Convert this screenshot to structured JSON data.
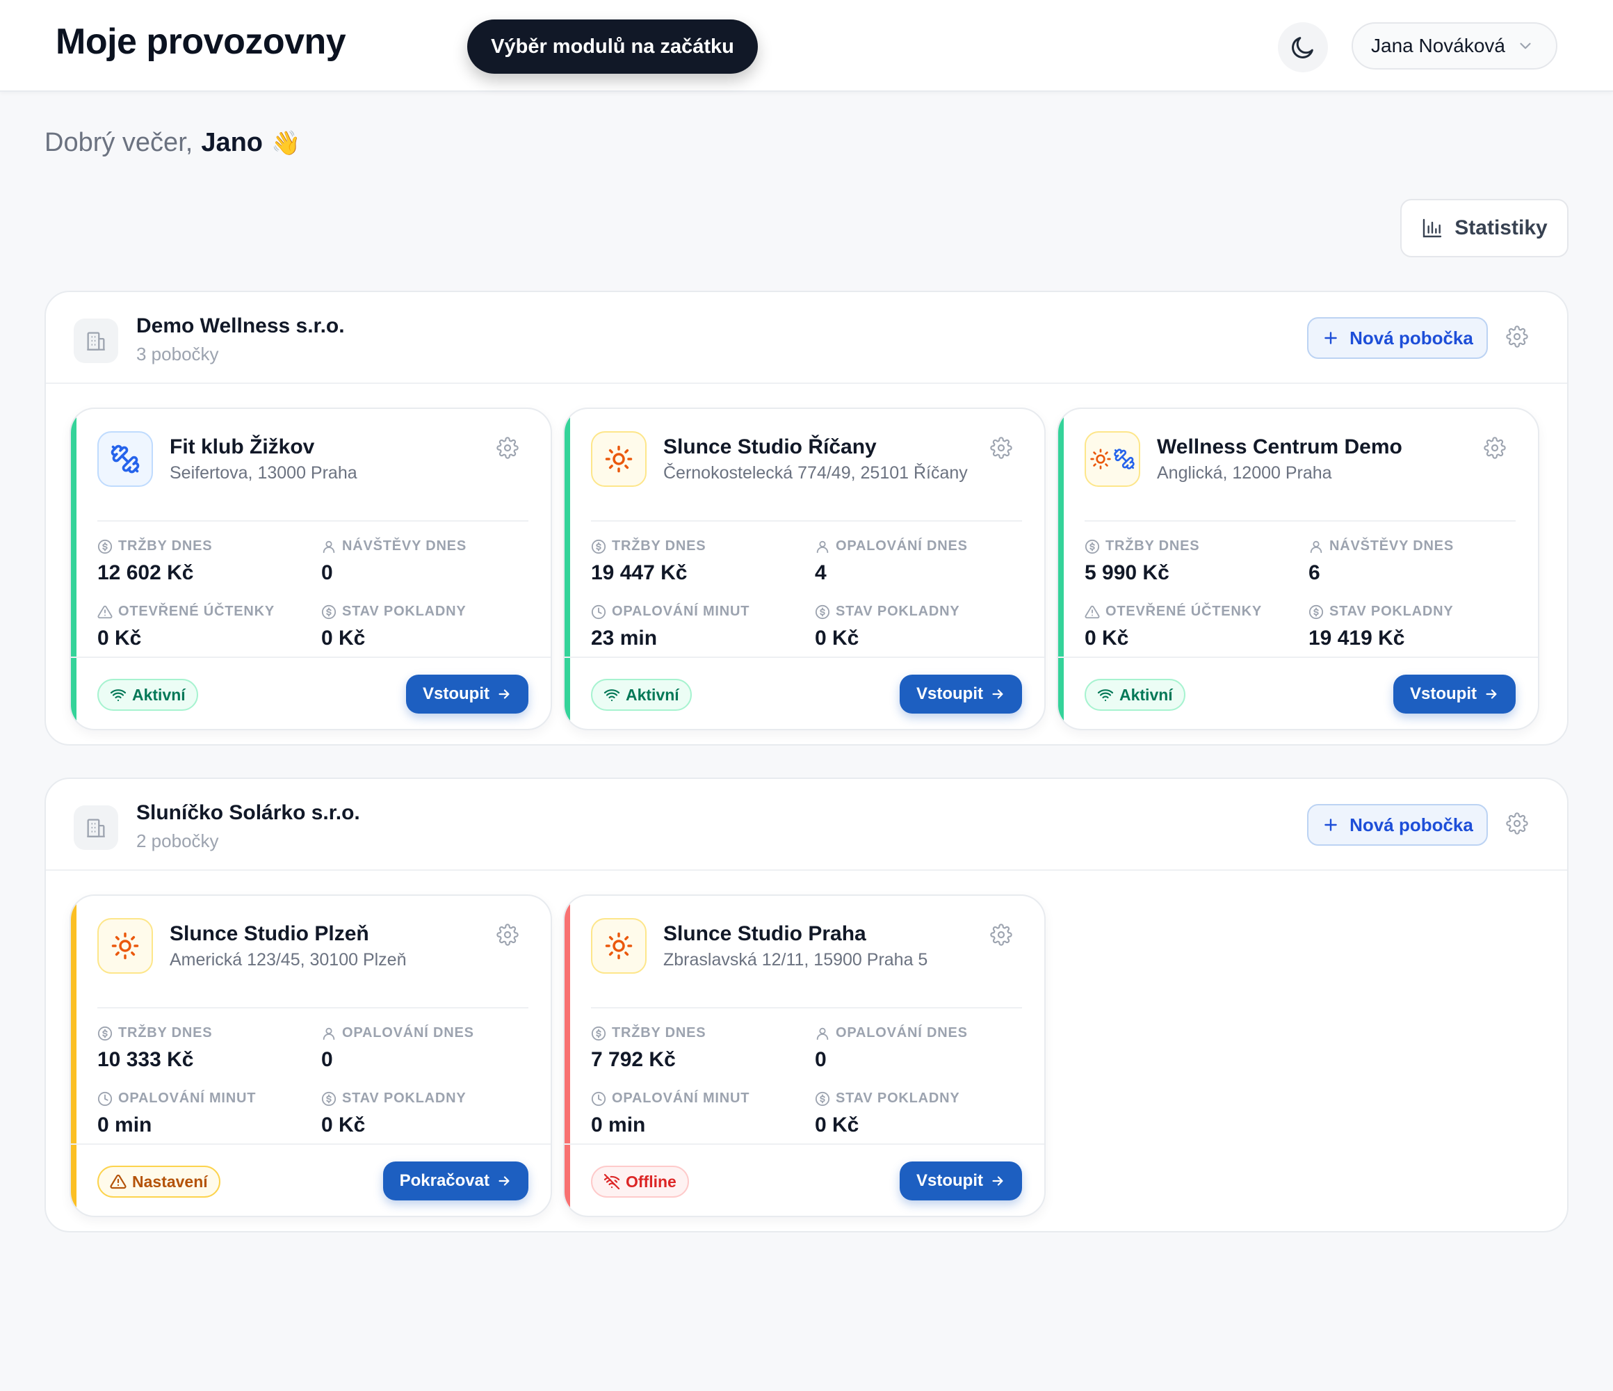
{
  "header": {
    "title": "Moje provozovny",
    "tooltip": "Výběr modulů na začátku",
    "theme_icon": "moon-icon",
    "user_name": "Jana Nováková"
  },
  "greeting": {
    "prefix": "Dobrý večer,",
    "name": "Jano",
    "emoji": "👋"
  },
  "stats_button": "Statistiky",
  "colors": {
    "accent_blue": "#1d5fc1",
    "active_green": "#34d399",
    "setup_amber": "#fbbf24",
    "offline_red": "#f87171"
  },
  "companies": [
    {
      "name": "Demo Wellness s.r.o.",
      "count": "3 pobočky",
      "new_branch": "Nová pobočka",
      "branches": [
        {
          "name": "Fit klub Žižkov",
          "address": "Seifertova, 13000 Praha",
          "icon": "dumbbell-icon",
          "metrics": [
            {
              "label": "Tržby dnes",
              "icon": "dollar-icon",
              "value": "12 602 Kč"
            },
            {
              "label": "Návštěvy dnes",
              "icon": "user-icon",
              "value": "0"
            },
            {
              "label": "Otevřené účtenky",
              "icon": "warning-icon",
              "value": "0 Kč"
            },
            {
              "label": "Stav pokladny",
              "icon": "dollar-icon",
              "value": "0 Kč"
            }
          ],
          "status": "Aktivní",
          "action": "Vstoupit"
        },
        {
          "name": "Slunce Studio Říčany",
          "address": "Černokostelecká 774/49, 25101 Říčany",
          "icon": "sun-icon",
          "metrics": [
            {
              "label": "Tržby dnes",
              "icon": "dollar-icon",
              "value": "19 447 Kč"
            },
            {
              "label": "Opalování dnes",
              "icon": "user-icon",
              "value": "4"
            },
            {
              "label": "Opalování minut",
              "icon": "clock-icon",
              "value": "23 min"
            },
            {
              "label": "Stav pokladny",
              "icon": "dollar-icon",
              "value": "0 Kč"
            }
          ],
          "status": "Aktivní",
          "action": "Vstoupit"
        },
        {
          "name": "Wellness Centrum Demo",
          "address": "Anglická, 12000 Praha",
          "icon": "sun-dumbbell-icon",
          "metrics": [
            {
              "label": "Tržby dnes",
              "icon": "dollar-icon",
              "value": "5 990 Kč"
            },
            {
              "label": "Návštěvy dnes",
              "icon": "user-icon",
              "value": "6"
            },
            {
              "label": "Otevřené účtenky",
              "icon": "warning-icon",
              "value": "0 Kč"
            },
            {
              "label": "Stav pokladny",
              "icon": "dollar-icon",
              "value": "19 419 Kč"
            }
          ],
          "status": "Aktivní",
          "action": "Vstoupit"
        }
      ]
    },
    {
      "name": "Sluníčko Solárko s.r.o.",
      "count": "2 pobočky",
      "new_branch": "Nová pobočka",
      "branches": [
        {
          "name": "Slunce Studio Plzeň",
          "address": "Americká 123/45, 30100 Plzeň",
          "icon": "sun-icon",
          "metrics": [
            {
              "label": "Tržby dnes",
              "icon": "dollar-icon",
              "value": "10 333 Kč"
            },
            {
              "label": "Opalování dnes",
              "icon": "user-icon",
              "value": "0"
            },
            {
              "label": "Opalování minut",
              "icon": "clock-icon",
              "value": "0 min"
            },
            {
              "label": "Stav pokladny",
              "icon": "dollar-icon",
              "value": "0 Kč"
            }
          ],
          "status": "Nastavení",
          "action": "Pokračovat"
        },
        {
          "name": "Slunce Studio Praha",
          "address": "Zbraslavská 12/11, 15900 Praha 5",
          "icon": "sun-icon",
          "metrics": [
            {
              "label": "Tržby dnes",
              "icon": "dollar-icon",
              "value": "7 792 Kč"
            },
            {
              "label": "Opalování dnes",
              "icon": "user-icon",
              "value": "0"
            },
            {
              "label": "Opalování minut",
              "icon": "clock-icon",
              "value": "0 min"
            },
            {
              "label": "Stav pokladny",
              "icon": "dollar-icon",
              "value": "0 Kč"
            }
          ],
          "status": "Offline",
          "action": "Vstoupit"
        }
      ]
    }
  ]
}
